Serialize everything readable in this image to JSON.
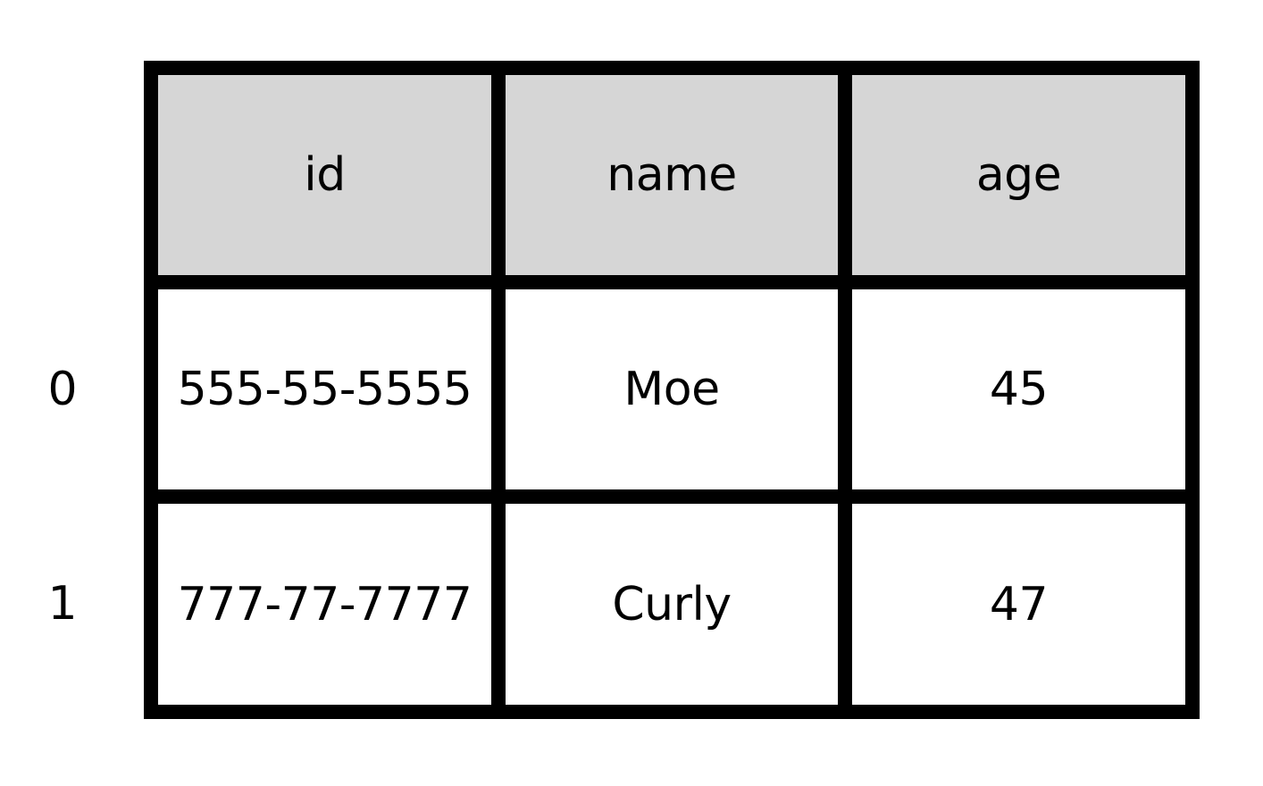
{
  "table": {
    "columns": [
      "id",
      "name",
      "age"
    ],
    "index": [
      "0",
      "1"
    ],
    "rows": [
      [
        "555-55-5555",
        "Moe",
        "45"
      ],
      [
        "777-77-7777",
        "Curly",
        "47"
      ]
    ]
  },
  "colors": {
    "header_fill": "#d6d6d6",
    "border": "#000000",
    "cell_fill": "#ffffff"
  }
}
